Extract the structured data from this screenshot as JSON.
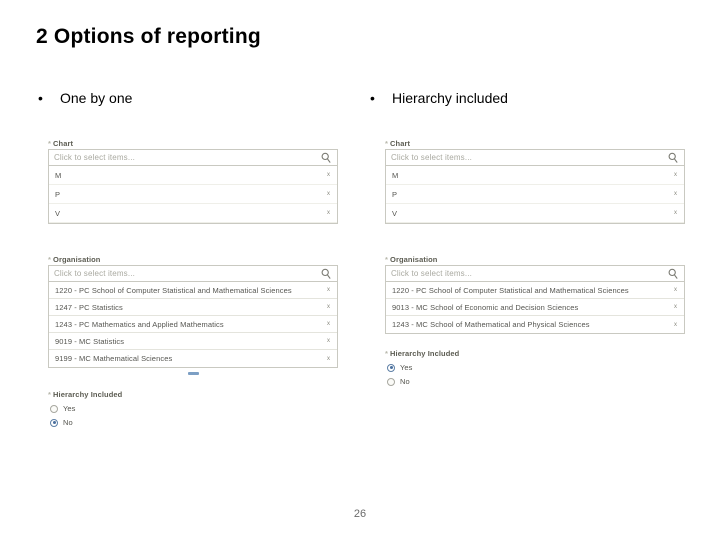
{
  "slide": {
    "title": "2 Options of reporting",
    "page_number": "26"
  },
  "bullets": {
    "dot": "•",
    "left_label": "One by one",
    "right_label": "Hierarchy included"
  },
  "left_panel": {
    "chart": {
      "required_mark": "*",
      "label": "Chart",
      "placeholder": "Click to select items...",
      "search_icon": "search-icon",
      "rows": [
        {
          "text": "M",
          "remove": "x"
        },
        {
          "text": "P",
          "remove": "x"
        },
        {
          "text": "V",
          "remove": "x"
        }
      ]
    },
    "organisation": {
      "required_mark": "*",
      "label": "Organisation",
      "placeholder": "Click to select items...",
      "search_icon": "search-icon",
      "rows": [
        {
          "text": "1220 - PC School of Computer Statistical and Mathematical Sciences",
          "remove": "x"
        },
        {
          "text": "1247 - PC Statistics",
          "remove": "x"
        },
        {
          "text": "1243 - PC Mathematics and Applied Mathematics",
          "remove": "x"
        },
        {
          "text": "9019 - MC Statistics",
          "remove": "x"
        },
        {
          "text": "9199 - MC Mathematical Sciences",
          "remove": "x"
        }
      ]
    },
    "hierarchy": {
      "required_mark": "*",
      "label": "Hierarchy Included",
      "options": [
        {
          "label": "Yes",
          "selected": false
        },
        {
          "label": "No",
          "selected": true
        }
      ]
    }
  },
  "right_panel": {
    "chart": {
      "required_mark": "*",
      "label": "Chart",
      "placeholder": "Click to select items...",
      "search_icon": "search-icon",
      "rows": [
        {
          "text": "M",
          "remove": "x"
        },
        {
          "text": "P",
          "remove": "x"
        },
        {
          "text": "V",
          "remove": "x"
        }
      ]
    },
    "organisation": {
      "required_mark": "*",
      "label": "Organisation",
      "placeholder": "Click to select items...",
      "search_icon": "search-icon",
      "rows": [
        {
          "text": "1220 - PC School of Computer Statistical and Mathematical Sciences",
          "remove": "x"
        },
        {
          "text": "9013 - MC School of Economic and Decision Sciences",
          "remove": "x"
        },
        {
          "text": "1243 - MC School of Mathematical and Physical Sciences",
          "remove": "x"
        }
      ]
    },
    "hierarchy": {
      "required_mark": "*",
      "label": "Hierarchy Included",
      "options": [
        {
          "label": "Yes",
          "selected": true
        },
        {
          "label": "No",
          "selected": false
        }
      ]
    }
  },
  "colors": {
    "border": "#c9c9c1",
    "text": "#555550",
    "placeholder": "#a9a9a0",
    "label": "#5c5c52",
    "radio_accent": "#4a6f9e",
    "handle": "#7c9fc4"
  }
}
